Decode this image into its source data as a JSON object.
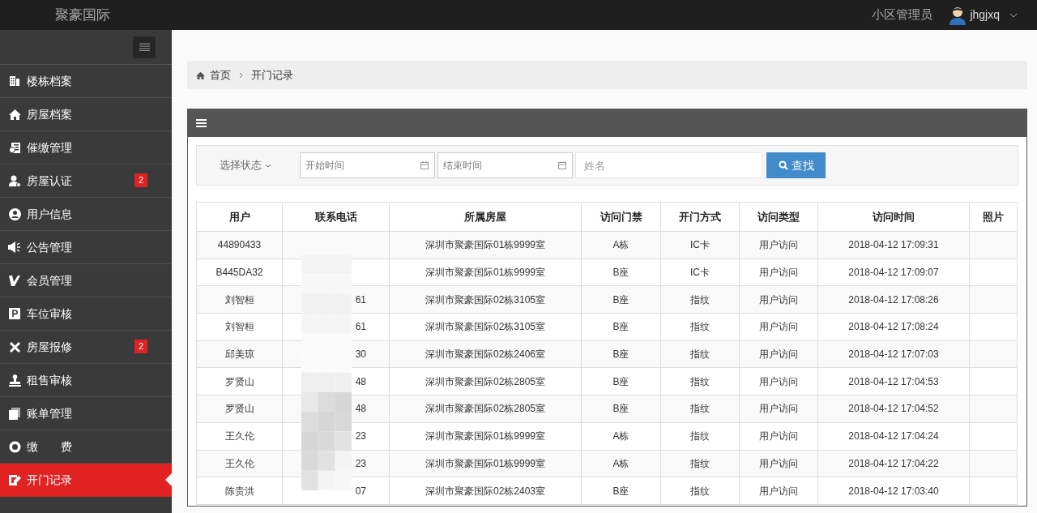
{
  "header": {
    "brand": "聚豪国际",
    "role": "小区管理员",
    "username": "jhgjxq"
  },
  "sidebar": {
    "items": [
      {
        "label": "楼栋档案",
        "selected": false
      },
      {
        "label": "房屋档案",
        "selected": false
      },
      {
        "label": "催缴管理",
        "selected": false
      },
      {
        "label": "房屋认证",
        "selected": false,
        "badge": "2"
      },
      {
        "label": "用户信息",
        "selected": false
      },
      {
        "label": "公告管理",
        "selected": false
      },
      {
        "label": "会员管理",
        "selected": false
      },
      {
        "label": "车位审核",
        "selected": false
      },
      {
        "label": "房屋报修",
        "selected": false,
        "badge": "2"
      },
      {
        "label": "租售审核",
        "selected": false
      },
      {
        "label": "账单管理",
        "selected": false
      },
      {
        "label": "缴　　费",
        "selected": false
      },
      {
        "label": "开门记录",
        "selected": true
      }
    ]
  },
  "breadcrumb": [
    "首页",
    "开门记录"
  ],
  "filters": {
    "status": "选择状态",
    "start_placeholder": "开始时间",
    "end_placeholder": "结束时间",
    "name_placeholder": "姓名",
    "search_button": "查找"
  },
  "table": {
    "columns": [
      "用户",
      "联系电话",
      "所属房屋",
      "访问门禁",
      "开门方式",
      "访问类型",
      "访问时间",
      "照片"
    ],
    "rows": [
      [
        "44890433",
        "",
        "深圳市聚豪国际01栋9999室",
        "A栋",
        "IC卡",
        "用户访问",
        "2018-04-12 17:09:31",
        ""
      ],
      [
        "B445DA32",
        "",
        "深圳市聚豪国际01栋9999室",
        "B座",
        "IC卡",
        "用户访问",
        "2018-04-12 17:09:07",
        ""
      ],
      [
        "刘智桓",
        "61",
        "深圳市聚豪国际02栋3105室",
        "B座",
        "指纹",
        "用户访问",
        "2018-04-12 17:08:26",
        ""
      ],
      [
        "刘智桓",
        "61",
        "深圳市聚豪国际02栋3105室",
        "B座",
        "指纹",
        "用户访问",
        "2018-04-12 17:08:24",
        ""
      ],
      [
        "邱美琼",
        "30",
        "深圳市聚豪国际02栋2406室",
        "B座",
        "指纹",
        "用户访问",
        "2018-04-12 17:07:03",
        ""
      ],
      [
        "罗贤山",
        "48",
        "深圳市聚豪国际02栋2805室",
        "B座",
        "指纹",
        "用户访问",
        "2018-04-12 17:04:53",
        ""
      ],
      [
        "罗贤山",
        "48",
        "深圳市聚豪国际02栋2805室",
        "B座",
        "指纹",
        "用户访问",
        "2018-04-12 17:04:52",
        ""
      ],
      [
        "王久伦",
        "23",
        "深圳市聚豪国际01栋9999室",
        "A栋",
        "指纹",
        "用户访问",
        "2018-04-12 17:04:24",
        ""
      ],
      [
        "王久伦",
        "23",
        "深圳市聚豪国际01栋9999室",
        "A栋",
        "指纹",
        "用户访问",
        "2018-04-12 17:04:22",
        ""
      ],
      [
        "陈贵洪",
        "07",
        "深圳市聚豪国际02栋2403室",
        "B座",
        "指纹",
        "用户访问",
        "2018-04-12 17:03:40",
        ""
      ]
    ]
  }
}
